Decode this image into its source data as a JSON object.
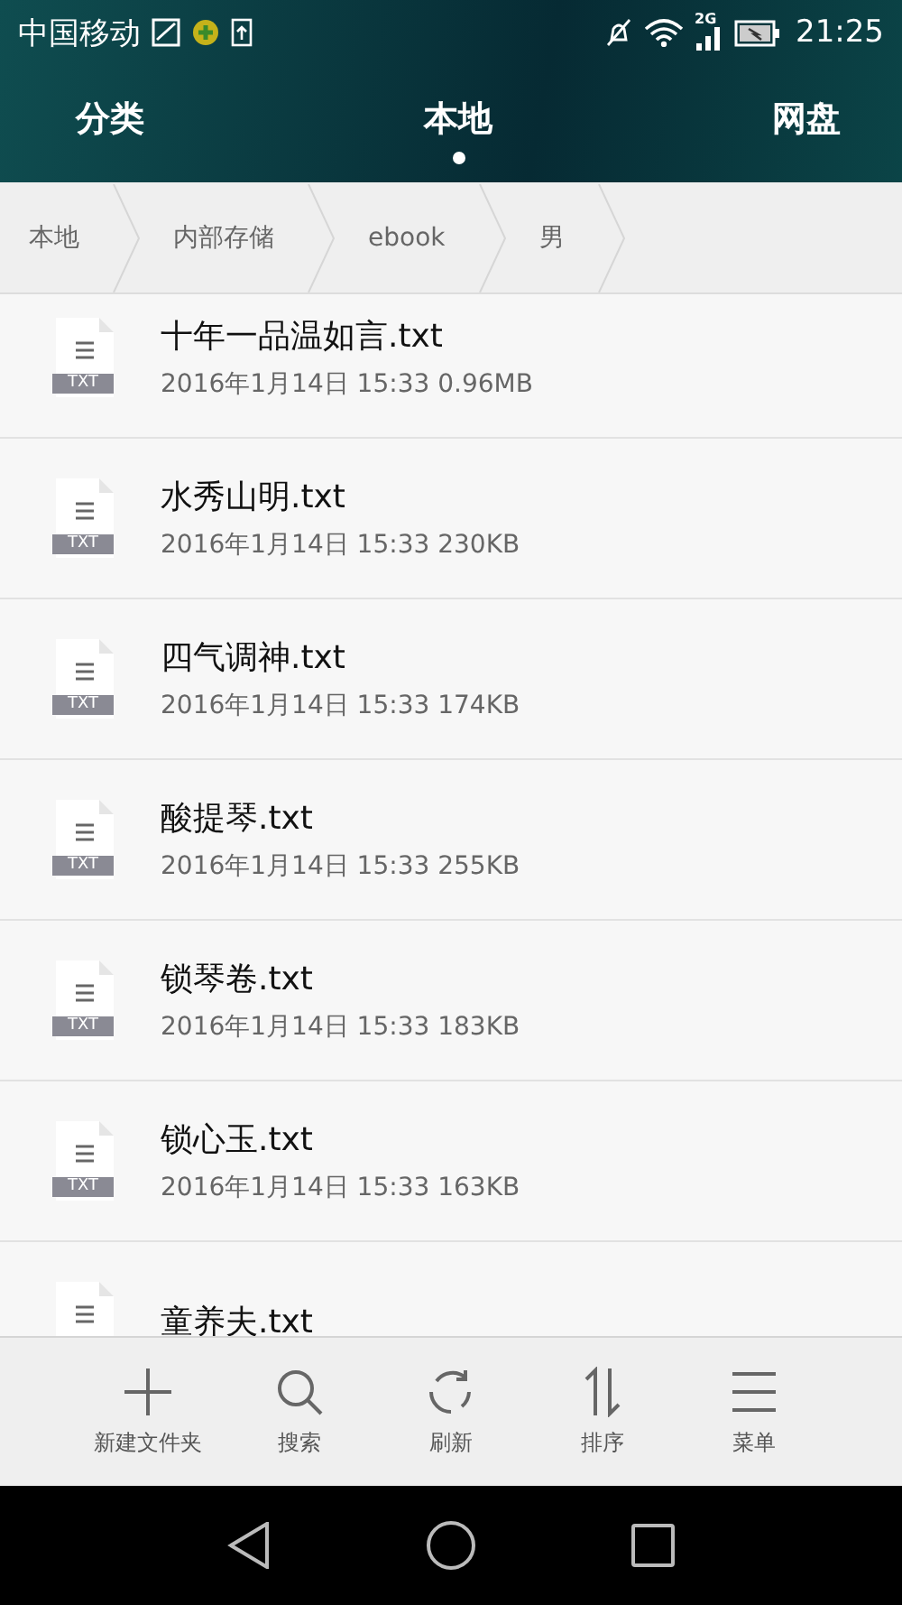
{
  "status_bar": {
    "carrier": "中国移动",
    "network": "2G",
    "time": "21:25"
  },
  "tabs": [
    {
      "label": "分类",
      "selected": false
    },
    {
      "label": "本地",
      "selected": true
    },
    {
      "label": "网盘",
      "selected": false
    }
  ],
  "breadcrumb": [
    "本地",
    "内部存储",
    "ebook",
    "男"
  ],
  "files": [
    {
      "name": "十年一品温如言.txt",
      "meta": "2016年1月14日 15:33 0.96MB",
      "icon_label": "TXT"
    },
    {
      "name": "水秀山明.txt",
      "meta": "2016年1月14日 15:33 230KB",
      "icon_label": "TXT"
    },
    {
      "name": "四气调神.txt",
      "meta": "2016年1月14日 15:33 174KB",
      "icon_label": "TXT"
    },
    {
      "name": "酸提琴.txt",
      "meta": "2016年1月14日 15:33 255KB",
      "icon_label": "TXT"
    },
    {
      "name": "锁琴卷.txt",
      "meta": "2016年1月14日 15:33 183KB",
      "icon_label": "TXT"
    },
    {
      "name": "锁心玉.txt",
      "meta": "2016年1月14日 15:33 163KB",
      "icon_label": "TXT"
    },
    {
      "name": "童养夫.txt"
    }
  ],
  "toolbar": [
    {
      "kind": "add",
      "label": "新建文件夹"
    },
    {
      "kind": "search",
      "label": "搜索"
    },
    {
      "kind": "refresh",
      "label": "刷新"
    },
    {
      "kind": "sort",
      "label": "排序"
    },
    {
      "kind": "menu",
      "label": "菜单"
    }
  ]
}
